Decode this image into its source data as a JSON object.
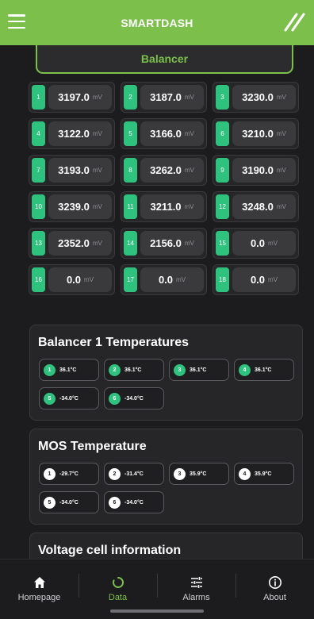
{
  "header": {
    "title": "SMARTDASH"
  },
  "balancer_button": {
    "label": "Balancer"
  },
  "cells": [
    {
      "index": "1",
      "value": "3197.0",
      "unit": "mV"
    },
    {
      "index": "2",
      "value": "3187.0",
      "unit": "mV"
    },
    {
      "index": "3",
      "value": "3230.0",
      "unit": "mV"
    },
    {
      "index": "4",
      "value": "3122.0",
      "unit": "mV"
    },
    {
      "index": "5",
      "value": "3166.0",
      "unit": "mV"
    },
    {
      "index": "6",
      "value": "3210.0",
      "unit": "mV"
    },
    {
      "index": "7",
      "value": "3193.0",
      "unit": "mV"
    },
    {
      "index": "8",
      "value": "3262.0",
      "unit": "mV"
    },
    {
      "index": "9",
      "value": "3190.0",
      "unit": "mV"
    },
    {
      "index": "10",
      "value": "3239.0",
      "unit": "mV"
    },
    {
      "index": "11",
      "value": "3211.0",
      "unit": "mV"
    },
    {
      "index": "12",
      "value": "3248.0",
      "unit": "mV"
    },
    {
      "index": "13",
      "value": "2352.0",
      "unit": "mV"
    },
    {
      "index": "14",
      "value": "2156.0",
      "unit": "mV"
    },
    {
      "index": "15",
      "value": "0.0",
      "unit": "mV"
    },
    {
      "index": "16",
      "value": "0.0",
      "unit": "mV"
    },
    {
      "index": "17",
      "value": "0.0",
      "unit": "mV"
    },
    {
      "index": "18",
      "value": "0.0",
      "unit": "mV"
    }
  ],
  "balancer_temps": {
    "title": "Balancer 1 Temperatures",
    "items": [
      {
        "index": "1",
        "value": "36.1°C"
      },
      {
        "index": "2",
        "value": "36.1°C"
      },
      {
        "index": "3",
        "value": "36.1°C"
      },
      {
        "index": "4",
        "value": "36.1°C"
      },
      {
        "index": "5",
        "value": "-34.0°C"
      },
      {
        "index": "6",
        "value": "-34.0°C"
      }
    ]
  },
  "mos_temps": {
    "title": "MOS Temperature",
    "items": [
      {
        "index": "1",
        "value": "-29.7°C"
      },
      {
        "index": "2",
        "value": "-31.4°C"
      },
      {
        "index": "3",
        "value": "35.9°C"
      },
      {
        "index": "4",
        "value": "35.9°C"
      },
      {
        "index": "5",
        "value": "-34.0°C"
      },
      {
        "index": "6",
        "value": "-34.0°C"
      }
    ]
  },
  "voltage_info": {
    "title": "Voltage cell information"
  },
  "nav": [
    {
      "label": "Homepage",
      "icon": "home-icon"
    },
    {
      "label": "Data",
      "icon": "refresh-icon"
    },
    {
      "label": "Alarms",
      "icon": "sliders-icon"
    },
    {
      "label": "About",
      "icon": "info-icon"
    }
  ],
  "colors": {
    "accent": "#7cc04b",
    "cell_badge": "#2ec27e",
    "background": "#1c1c1e"
  }
}
